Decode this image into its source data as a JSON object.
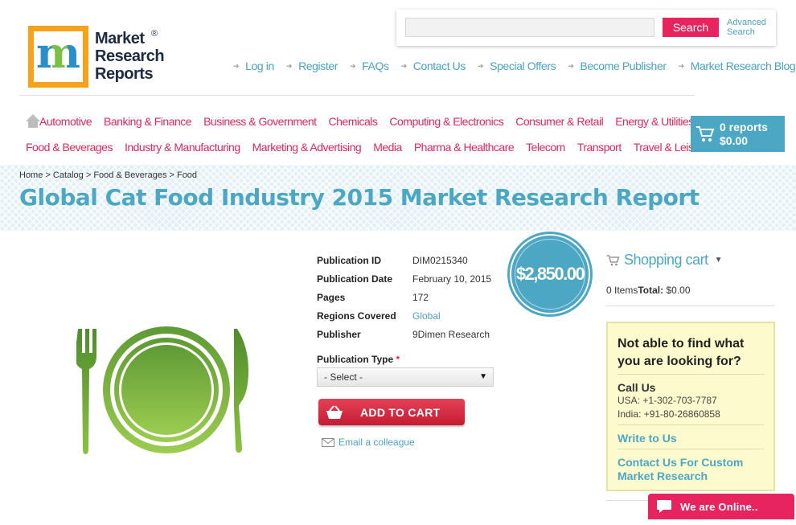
{
  "logo": {
    "line1": "Market",
    "line2": "Research",
    "line3": "Reports",
    "reg": "®",
    "mark": "m"
  },
  "search": {
    "button": "Search",
    "advanced_line1": "Advanced",
    "advanced_line2": "Search",
    "placeholder": ""
  },
  "top_nav": [
    "Log in",
    "Register",
    "FAQs",
    "Contact Us",
    "Special Offers",
    "Become Publisher",
    "Market Research Blog"
  ],
  "categories_row1": [
    "Automotive",
    "Banking & Finance",
    "Business & Government",
    "Chemicals",
    "Computing & Electronics",
    "Consumer & Retail",
    "Energy & Utilities"
  ],
  "categories_row2": [
    "Food & Beverages",
    "Industry & Manufacturing",
    "Marketing & Advertising",
    "Media",
    "Pharma & Healthcare",
    "Telecom",
    "Transport",
    "Travel & Leisure"
  ],
  "cart": {
    "reports": "0 reports",
    "amount": "$0.00"
  },
  "breadcrumb": "Home > Catalog > Food & Beverages > Food",
  "title": "Global Cat Food Industry 2015 Market Research Report",
  "details": {
    "rows": [
      {
        "key": "Publication ID",
        "value": "DIM0215340"
      },
      {
        "key": "Publication Date",
        "value": "February 10, 2015"
      },
      {
        "key": "Pages",
        "value": "172"
      },
      {
        "key": "Regions Covered",
        "value": "Global"
      },
      {
        "key": "Publisher",
        "value": "9Dimen Research"
      }
    ]
  },
  "price": "$2,850.00",
  "publication_type": {
    "label": "Publication Type",
    "required": "*",
    "selected": "- Select -"
  },
  "add_to_cart": "ADD TO CART",
  "email_colleague": "Email a colleague",
  "shopping_cart": {
    "title": "Shopping cart",
    "items": "0 Items",
    "total_label": "Total:",
    "total": "$0.00"
  },
  "help": {
    "question": "Not able to find what you are looking for?",
    "call_us": "Call Us",
    "usa": "USA: +1-302-703-7787",
    "india": "India: +91-80-26860858",
    "write": "Write to Us",
    "custom": "Contact Us For Custom Market Research"
  },
  "online": "We are Online..",
  "colors": {
    "accent": "#4ba7c4",
    "pink": "#e2275b",
    "help_bg": "#fdfbcd"
  }
}
